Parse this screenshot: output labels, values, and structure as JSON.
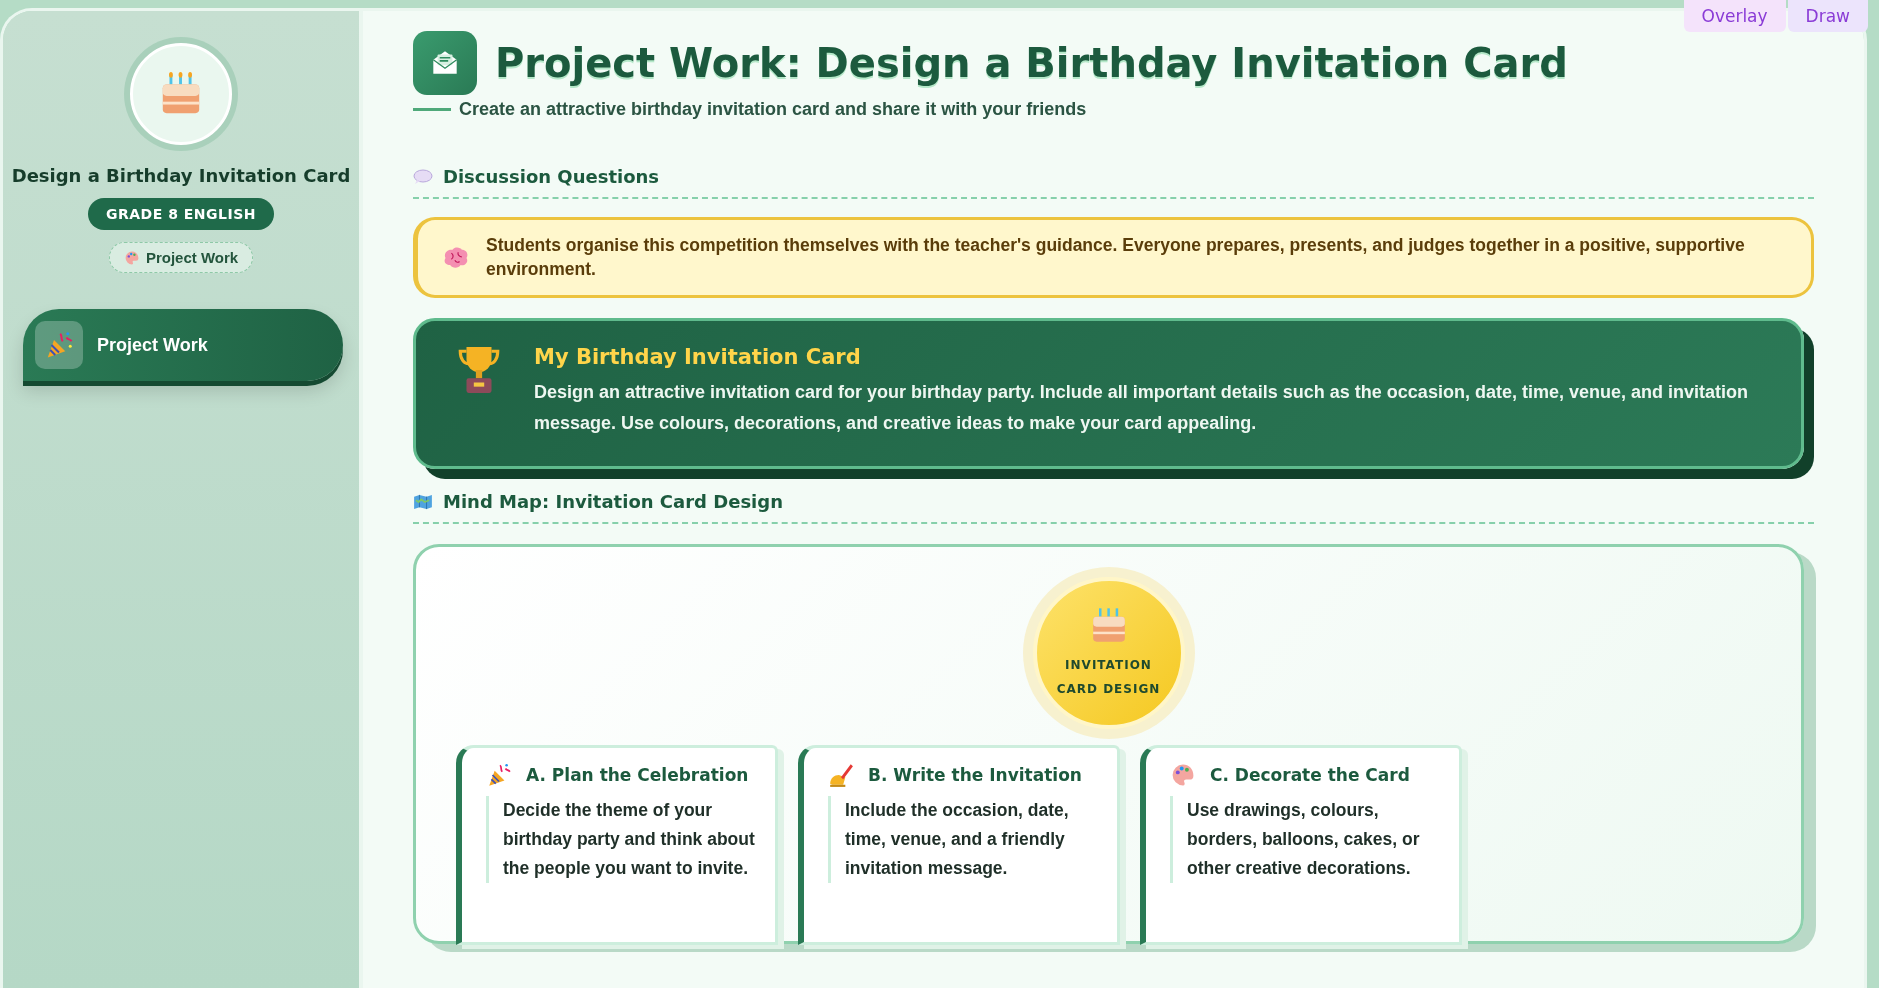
{
  "top_buttons": [
    {
      "label": "Overlay",
      "kind": "overlay"
    },
    {
      "label": "Draw",
      "kind": "draw"
    }
  ],
  "sidebar": {
    "title": "Design a Birthday Invitation Card",
    "badge": "GRADE 8 ENGLISH",
    "tag": "Project Work",
    "nav": [
      {
        "label": "Project Work",
        "selected": true
      }
    ]
  },
  "header": {
    "title": "Project Work: Design a Birthday Invitation Card",
    "subtitle": "Create an attractive birthday invitation card and share it with your friends"
  },
  "discussion": {
    "heading": "Discussion Questions",
    "note": "Students organise this competition themselves with the teacher's guidance. Everyone prepares, presents, and judges together in a positive, supportive environment.",
    "task": {
      "title": "My Birthday Invitation Card",
      "text": "Design an attractive invitation card for your birthday party. Include all important details such as the occasion, date, time, venue, and invitation message. Use colours, decorations, and creative ideas to make your card appealing."
    }
  },
  "mind_map": {
    "heading": "Mind Map: Invitation Card Design",
    "center": "INVITATION CARD DESIGN",
    "branches": [
      {
        "kind": "popper",
        "title": "A. Plan the Celebration",
        "text": "Decide the theme of your birthday party and think about the people you want to invite."
      },
      {
        "kind": "writing",
        "title": "B. Write the Invitation",
        "text": "Include the occasion, date, time, venue, and a friendly invitation message."
      },
      {
        "kind": "palette",
        "title": "C. Decorate the Card",
        "text": "Use drawings, colours, borders, balloons, cakes, or other creative decorations."
      }
    ]
  }
}
